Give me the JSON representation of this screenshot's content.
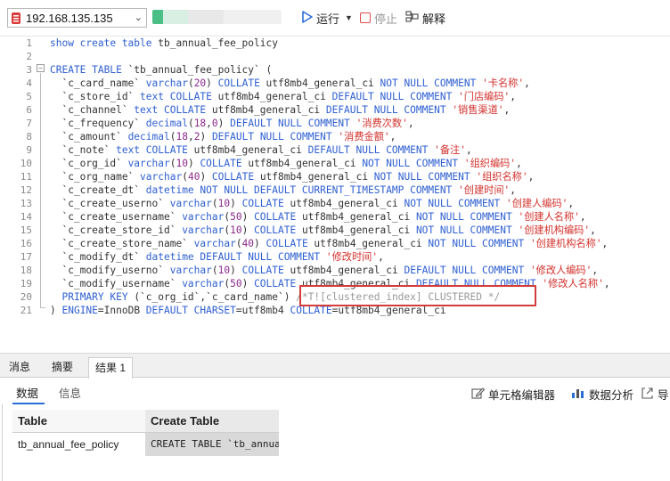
{
  "toolbar": {
    "connection": "192.168.135.135",
    "run_label": "运行",
    "stop_label": "停止",
    "explain_label": "解释"
  },
  "editor": {
    "line_numbers": [
      "1",
      "2",
      "3",
      "4",
      "5",
      "6",
      "7",
      "8",
      "9",
      "10",
      "11",
      "12",
      "13",
      "14",
      "15",
      "16",
      "17",
      "18",
      "19",
      "20",
      "21"
    ],
    "lines": [
      [
        {
          "t": "kw",
          "s": "show create table"
        },
        {
          "t": "plain",
          "s": " tb_annual_fee_policy"
        }
      ],
      [],
      [
        {
          "t": "kw",
          "s": "CREATE TABLE"
        },
        {
          "t": "plain",
          "s": " `tb_annual_fee_policy` ("
        }
      ],
      [
        {
          "t": "plain",
          "s": "  `c_card_name` "
        },
        {
          "t": "kw",
          "s": "varchar"
        },
        {
          "t": "plain",
          "s": "("
        },
        {
          "t": "num",
          "s": "20"
        },
        {
          "t": "plain",
          "s": ") "
        },
        {
          "t": "kw",
          "s": "COLLATE"
        },
        {
          "t": "plain",
          "s": " utf8mb4_general_ci "
        },
        {
          "t": "kw",
          "s": "NOT NULL COMMENT"
        },
        {
          "t": "plain",
          "s": " "
        },
        {
          "t": "str",
          "s": "'卡名称'"
        },
        {
          "t": "plain",
          "s": ","
        }
      ],
      [
        {
          "t": "plain",
          "s": "  `c_store_id` "
        },
        {
          "t": "kw",
          "s": "text COLLATE"
        },
        {
          "t": "plain",
          "s": " utf8mb4_general_ci "
        },
        {
          "t": "kw",
          "s": "DEFAULT NULL COMMENT"
        },
        {
          "t": "plain",
          "s": " "
        },
        {
          "t": "str",
          "s": "'门店编码'"
        },
        {
          "t": "plain",
          "s": ","
        }
      ],
      [
        {
          "t": "plain",
          "s": "  `c_channel` "
        },
        {
          "t": "kw",
          "s": "text COLLATE"
        },
        {
          "t": "plain",
          "s": " utf8mb4_general_ci "
        },
        {
          "t": "kw",
          "s": "DEFAULT NULL COMMENT"
        },
        {
          "t": "plain",
          "s": " "
        },
        {
          "t": "str",
          "s": "'销售渠道'"
        },
        {
          "t": "plain",
          "s": ","
        }
      ],
      [
        {
          "t": "plain",
          "s": "  `c_frequency` "
        },
        {
          "t": "kw",
          "s": "decimal"
        },
        {
          "t": "plain",
          "s": "("
        },
        {
          "t": "num",
          "s": "18"
        },
        {
          "t": "plain",
          "s": ","
        },
        {
          "t": "num",
          "s": "0"
        },
        {
          "t": "plain",
          "s": ") "
        },
        {
          "t": "kw",
          "s": "DEFAULT NULL COMMENT"
        },
        {
          "t": "plain",
          "s": " "
        },
        {
          "t": "str",
          "s": "'消费次数'"
        },
        {
          "t": "plain",
          "s": ","
        }
      ],
      [
        {
          "t": "plain",
          "s": "  `c_amount` "
        },
        {
          "t": "kw",
          "s": "decimal"
        },
        {
          "t": "plain",
          "s": "("
        },
        {
          "t": "num",
          "s": "18"
        },
        {
          "t": "plain",
          "s": ","
        },
        {
          "t": "num",
          "s": "2"
        },
        {
          "t": "plain",
          "s": ") "
        },
        {
          "t": "kw",
          "s": "DEFAULT NULL COMMENT"
        },
        {
          "t": "plain",
          "s": " "
        },
        {
          "t": "str",
          "s": "'消费金额'"
        },
        {
          "t": "plain",
          "s": ","
        }
      ],
      [
        {
          "t": "plain",
          "s": "  `c_note` "
        },
        {
          "t": "kw",
          "s": "text COLLATE"
        },
        {
          "t": "plain",
          "s": " utf8mb4_general_ci "
        },
        {
          "t": "kw",
          "s": "DEFAULT NULL COMMENT"
        },
        {
          "t": "plain",
          "s": " "
        },
        {
          "t": "str",
          "s": "'备注'"
        },
        {
          "t": "plain",
          "s": ","
        }
      ],
      [
        {
          "t": "plain",
          "s": "  `c_org_id` "
        },
        {
          "t": "kw",
          "s": "varchar"
        },
        {
          "t": "plain",
          "s": "("
        },
        {
          "t": "num",
          "s": "10"
        },
        {
          "t": "plain",
          "s": ") "
        },
        {
          "t": "kw",
          "s": "COLLATE"
        },
        {
          "t": "plain",
          "s": " utf8mb4_general_ci "
        },
        {
          "t": "kw",
          "s": "NOT NULL COMMENT"
        },
        {
          "t": "plain",
          "s": " "
        },
        {
          "t": "str",
          "s": "'组织编码'"
        },
        {
          "t": "plain",
          "s": ","
        }
      ],
      [
        {
          "t": "plain",
          "s": "  `c_org_name` "
        },
        {
          "t": "kw",
          "s": "varchar"
        },
        {
          "t": "plain",
          "s": "("
        },
        {
          "t": "num",
          "s": "40"
        },
        {
          "t": "plain",
          "s": ") "
        },
        {
          "t": "kw",
          "s": "COLLATE"
        },
        {
          "t": "plain",
          "s": " utf8mb4_general_ci "
        },
        {
          "t": "kw",
          "s": "NOT NULL COMMENT"
        },
        {
          "t": "plain",
          "s": " "
        },
        {
          "t": "str",
          "s": "'组织名称'"
        },
        {
          "t": "plain",
          "s": ","
        }
      ],
      [
        {
          "t": "plain",
          "s": "  `c_create_dt` "
        },
        {
          "t": "kw",
          "s": "datetime NOT NULL DEFAULT CURRENT_TIMESTAMP COMMENT"
        },
        {
          "t": "plain",
          "s": " "
        },
        {
          "t": "str",
          "s": "'创建时间'"
        },
        {
          "t": "plain",
          "s": ","
        }
      ],
      [
        {
          "t": "plain",
          "s": "  `c_create_userno` "
        },
        {
          "t": "kw",
          "s": "varchar"
        },
        {
          "t": "plain",
          "s": "("
        },
        {
          "t": "num",
          "s": "10"
        },
        {
          "t": "plain",
          "s": ") "
        },
        {
          "t": "kw",
          "s": "COLLATE"
        },
        {
          "t": "plain",
          "s": " utf8mb4_general_ci "
        },
        {
          "t": "kw",
          "s": "NOT NULL COMMENT"
        },
        {
          "t": "plain",
          "s": " "
        },
        {
          "t": "str",
          "s": "'创建人编码'"
        },
        {
          "t": "plain",
          "s": ","
        }
      ],
      [
        {
          "t": "plain",
          "s": "  `c_create_username` "
        },
        {
          "t": "kw",
          "s": "varchar"
        },
        {
          "t": "plain",
          "s": "("
        },
        {
          "t": "num",
          "s": "50"
        },
        {
          "t": "plain",
          "s": ") "
        },
        {
          "t": "kw",
          "s": "COLLATE"
        },
        {
          "t": "plain",
          "s": " utf8mb4_general_ci "
        },
        {
          "t": "kw",
          "s": "NOT NULL COMMENT"
        },
        {
          "t": "plain",
          "s": " "
        },
        {
          "t": "str",
          "s": "'创建人名称'"
        },
        {
          "t": "plain",
          "s": ","
        }
      ],
      [
        {
          "t": "plain",
          "s": "  `c_create_store_id` "
        },
        {
          "t": "kw",
          "s": "varchar"
        },
        {
          "t": "plain",
          "s": "("
        },
        {
          "t": "num",
          "s": "10"
        },
        {
          "t": "plain",
          "s": ") "
        },
        {
          "t": "kw",
          "s": "COLLATE"
        },
        {
          "t": "plain",
          "s": " utf8mb4_general_ci "
        },
        {
          "t": "kw",
          "s": "NOT NULL COMMENT"
        },
        {
          "t": "plain",
          "s": " "
        },
        {
          "t": "str",
          "s": "'创建机构编码'"
        },
        {
          "t": "plain",
          "s": ","
        }
      ],
      [
        {
          "t": "plain",
          "s": "  `c_create_store_name` "
        },
        {
          "t": "kw",
          "s": "varchar"
        },
        {
          "t": "plain",
          "s": "("
        },
        {
          "t": "num",
          "s": "40"
        },
        {
          "t": "plain",
          "s": ") "
        },
        {
          "t": "kw",
          "s": "COLLATE"
        },
        {
          "t": "plain",
          "s": " utf8mb4_general_ci "
        },
        {
          "t": "kw",
          "s": "NOT NULL COMMENT"
        },
        {
          "t": "plain",
          "s": " "
        },
        {
          "t": "str",
          "s": "'创建机构名称'"
        },
        {
          "t": "plain",
          "s": ","
        }
      ],
      [
        {
          "t": "plain",
          "s": "  `c_modify_dt` "
        },
        {
          "t": "kw",
          "s": "datetime DEFAULT NULL COMMENT"
        },
        {
          "t": "plain",
          "s": " "
        },
        {
          "t": "str",
          "s": "'修改时间'"
        },
        {
          "t": "plain",
          "s": ","
        }
      ],
      [
        {
          "t": "plain",
          "s": "  `c_modify_userno` "
        },
        {
          "t": "kw",
          "s": "varchar"
        },
        {
          "t": "plain",
          "s": "("
        },
        {
          "t": "num",
          "s": "10"
        },
        {
          "t": "plain",
          "s": ") "
        },
        {
          "t": "kw",
          "s": "COLLATE"
        },
        {
          "t": "plain",
          "s": " utf8mb4_general_ci "
        },
        {
          "t": "kw",
          "s": "DEFAULT NULL COMMENT"
        },
        {
          "t": "plain",
          "s": " "
        },
        {
          "t": "str",
          "s": "'修改人编码'"
        },
        {
          "t": "plain",
          "s": ","
        }
      ],
      [
        {
          "t": "plain",
          "s": "  `c_modify_username` "
        },
        {
          "t": "kw",
          "s": "varchar"
        },
        {
          "t": "plain",
          "s": "("
        },
        {
          "t": "num",
          "s": "50"
        },
        {
          "t": "plain",
          "s": ") "
        },
        {
          "t": "kw",
          "s": "COLLATE"
        },
        {
          "t": "plain",
          "s": " utf8mb4_general_ci "
        },
        {
          "t": "kw",
          "s": "DEFAULT NULL COMMENT"
        },
        {
          "t": "plain",
          "s": " "
        },
        {
          "t": "str",
          "s": "'修改人名称'"
        },
        {
          "t": "plain",
          "s": ","
        }
      ],
      [
        {
          "t": "plain",
          "s": "  "
        },
        {
          "t": "kw",
          "s": "PRIMARY KEY"
        },
        {
          "t": "plain",
          "s": " (`c_org_id`,`c_card_name`) "
        },
        {
          "t": "cmt",
          "s": "/*T![clustered_index] CLUSTERED */"
        }
      ],
      [
        {
          "t": "plain",
          "s": ") "
        },
        {
          "t": "kw",
          "s": "ENGINE"
        },
        {
          "t": "plain",
          "s": "=InnoDB "
        },
        {
          "t": "kw",
          "s": "DEFAULT CHARSET"
        },
        {
          "t": "plain",
          "s": "=utf8mb4 "
        },
        {
          "t": "kw",
          "s": "COLLATE"
        },
        {
          "t": "plain",
          "s": "=utf8mb4_general_ci"
        }
      ]
    ]
  },
  "panel": {
    "tabs": [
      "消息",
      "摘要",
      "结果 1"
    ],
    "subtabs": [
      "数据",
      "信息"
    ],
    "tools": [
      "单元格编辑器",
      "数据分析",
      "导"
    ],
    "table": {
      "columns": [
        "Table",
        "Create Table"
      ],
      "rows": [
        [
          "tb_annual_fee_policy",
          "CREATE TABLE `tb_annual_fee_policy`"
        ]
      ]
    }
  },
  "colors": {
    "keyword": "#2e5fd1",
    "string": "#d2322d",
    "number": "#8b2a8b",
    "comment": "#999999",
    "highlight_box": "#d43b3b",
    "run_icon": "#2a6fd6"
  }
}
